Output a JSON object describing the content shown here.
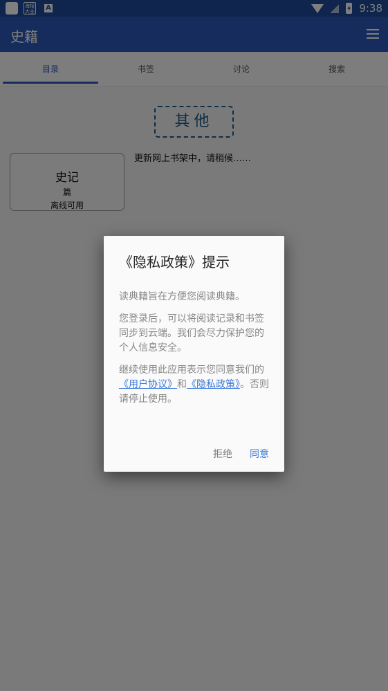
{
  "status_bar": {
    "time": "9:38",
    "app_icon2_text": "海报大全",
    "icon_a": "A"
  },
  "app_bar": {
    "title": "史籍",
    "menu_icon": "menu-icon"
  },
  "tabs": [
    {
      "label": "目录",
      "active": true
    },
    {
      "label": "书签",
      "active": false
    },
    {
      "label": "讨论",
      "active": false
    },
    {
      "label": "搜索",
      "active": false
    }
  ],
  "content": {
    "category": "其他",
    "updating": "更新网上书架中，请稍候……",
    "book": {
      "title": "史记",
      "count": "篇",
      "status": "离线可用"
    }
  },
  "dialog": {
    "title": "《隐私政策》提示",
    "p1": "读典籍旨在方便您阅读典籍。",
    "p2": "您登录后，可以将阅读记录和书签同步到云端。我们会尽力保护您的个人信息安全。",
    "p3_pre": "继续使用此应用表示您同意我们的",
    "link_agreement": "《用户协议》",
    "p3_and": "和",
    "link_privacy": "《隐私政策》",
    "p3_post": "。否则请停止使用。",
    "refuse": "拒绝",
    "agree": "同意"
  },
  "colors": {
    "primary": "#2a58b8",
    "status_bar": "#1e4a9b",
    "category": "#1e5a87",
    "link": "#3a78d8"
  }
}
